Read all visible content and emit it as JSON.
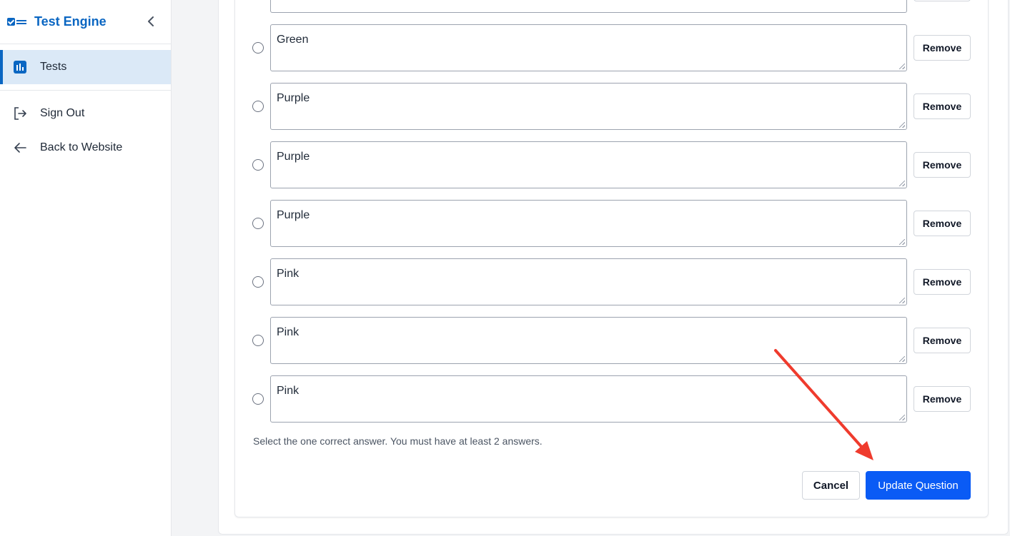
{
  "sidebar": {
    "brand_title": "Test Engine",
    "collapse_icon": "chevron-left-icon",
    "items": [
      {
        "label": "Tests",
        "icon": "bar-chart-icon",
        "active": true
      },
      {
        "label": "Sign Out",
        "icon": "sign-out-icon",
        "active": false
      },
      {
        "label": "Back to Website",
        "icon": "arrow-left-icon",
        "active": false
      }
    ]
  },
  "answers": [
    {
      "text": "Green",
      "remove_label": "Remove"
    },
    {
      "text": "Purple",
      "remove_label": "Remove"
    },
    {
      "text": "Purple",
      "remove_label": "Remove"
    },
    {
      "text": "Purple",
      "remove_label": "Remove"
    },
    {
      "text": "Pink",
      "remove_label": "Remove"
    },
    {
      "text": "Pink",
      "remove_label": "Remove"
    },
    {
      "text": "Pink",
      "remove_label": "Remove"
    }
  ],
  "hint": "Select the one correct answer. You must have at least 2 answers.",
  "actions": {
    "cancel_label": "Cancel",
    "update_label": "Update Question"
  },
  "colors": {
    "brand": "#0a66c2",
    "primary_button": "#0a5bf5",
    "annotation_arrow": "#ef3b2d"
  }
}
